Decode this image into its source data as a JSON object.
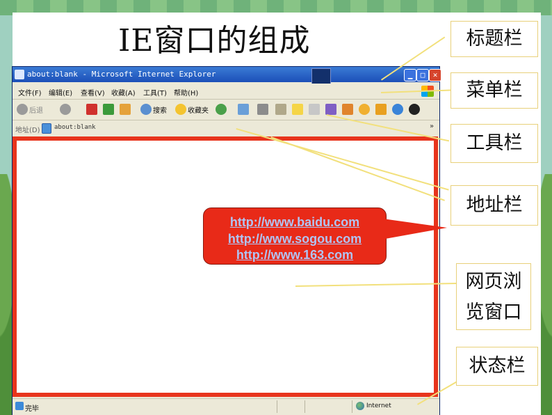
{
  "slide_title": "IE窗口的组成",
  "ie_window": {
    "title_text": "about:blank - Microsoft Internet Explorer",
    "menu_items": [
      "文件(F)",
      "编辑(E)",
      "查看(V)",
      "收藏(A)",
      "工具(T)",
      "帮助(H)"
    ],
    "toolbar": {
      "back_label": "后退",
      "search_label": "搜索",
      "favorites_label": "收藏夹"
    },
    "address": {
      "label": "地址(D)",
      "value": "about:blank"
    },
    "status": {
      "text": "完毕",
      "zone": "Internet"
    }
  },
  "callout": {
    "urls": [
      "http://www.baidu.com",
      "http://www.sogou.com",
      "http://www.163.com"
    ]
  },
  "labels": {
    "title_bar": "标题栏",
    "menu_bar": "菜单栏",
    "toolbar": "工具栏",
    "address_bar": "地址栏",
    "browse_window_line1": "网页浏",
    "browse_window_line2": "览窗口",
    "status_bar": "状态栏"
  },
  "colors": {
    "content_border": "#e8341c",
    "callout_fill": "#e82a18",
    "label_border": "#e8d07a",
    "leader_line": "#f2e07c"
  }
}
